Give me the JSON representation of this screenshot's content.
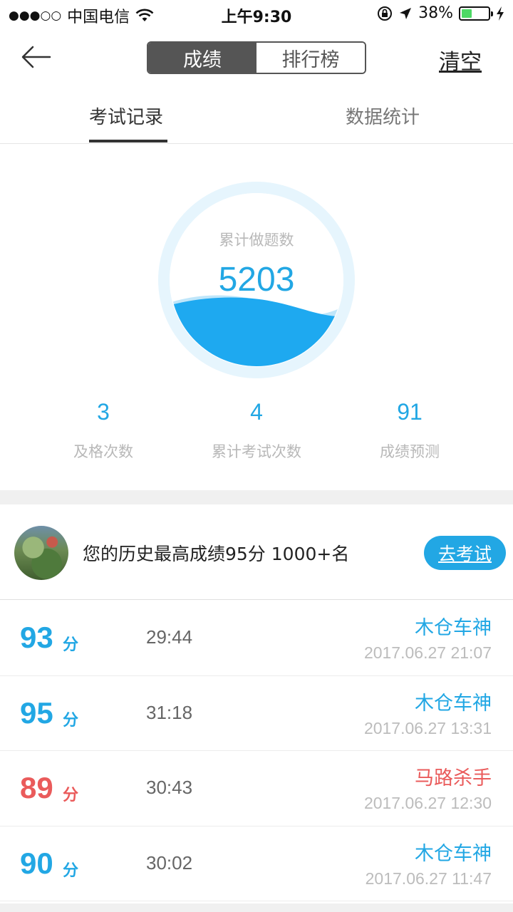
{
  "status_bar": {
    "carrier": "中国电信",
    "time": "上午9:30",
    "battery": "38%",
    "battery_level": 0.38
  },
  "nav": {
    "seg_score": "成绩",
    "seg_rank": "排行榜",
    "clear": "清空"
  },
  "tabs": {
    "records": "考试记录",
    "stats": "数据统计"
  },
  "circle": {
    "label": "累计做题数",
    "value": "5203"
  },
  "stats": [
    {
      "value": "3",
      "label": "及格次数"
    },
    {
      "value": "4",
      "label": "累计考试次数"
    },
    {
      "value": "91",
      "label": "成绩预测"
    }
  ],
  "best": {
    "text": "您的历史最高成绩95分 1000+名",
    "button": "去考试"
  },
  "records": [
    {
      "score": "93",
      "unit": "分",
      "duration": "29:44",
      "title": "木仓车神",
      "time": "2017.06.27 21:07",
      "color": "#22a7e4"
    },
    {
      "score": "95",
      "unit": "分",
      "duration": "31:18",
      "title": "木仓车神",
      "time": "2017.06.27 13:31",
      "color": "#22a7e4"
    },
    {
      "score": "89",
      "unit": "分",
      "duration": "30:43",
      "title": "马路杀手",
      "time": "2017.06.27 12:30",
      "color": "#ea5b5b"
    },
    {
      "score": "90",
      "unit": "分",
      "duration": "30:02",
      "title": "木仓车神",
      "time": "2017.06.27 11:47",
      "color": "#22a7e4"
    }
  ],
  "colors": {
    "accent": "#22a7e4",
    "fail": "#ea5b5b"
  }
}
